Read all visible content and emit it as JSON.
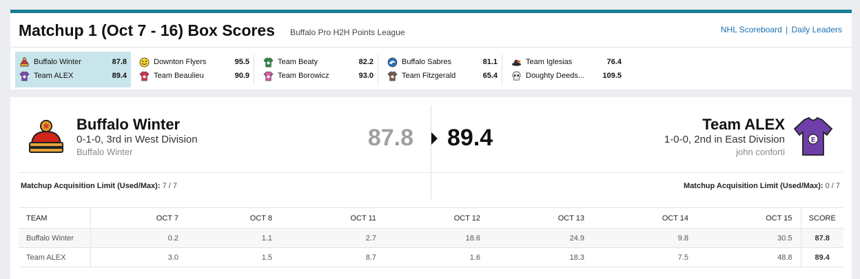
{
  "header": {
    "title": "Matchup 1 (Oct 7 - 16) Box Scores",
    "league": "Buffalo Pro H2H Points League",
    "links": [
      "NHL Scoreboard",
      "Daily Leaders"
    ],
    "separator": "|"
  },
  "matchups": [
    {
      "active": true,
      "teams": [
        {
          "name": "Buffalo Winter",
          "score": "87.8",
          "icon": "winter-hat-icon"
        },
        {
          "name": "Team ALEX",
          "score": "89.4",
          "icon": "purple-jersey-icon"
        }
      ]
    },
    {
      "active": false,
      "teams": [
        {
          "name": "Downton Flyers",
          "score": "95.5",
          "icon": "smiley-face-icon"
        },
        {
          "name": "Team Beaulieu",
          "score": "90.9",
          "icon": "red-jersey-icon"
        }
      ]
    },
    {
      "active": false,
      "teams": [
        {
          "name": "Team Beaty",
          "score": "82.2",
          "icon": "green-jersey-icon"
        },
        {
          "name": "Team Borowicz",
          "score": "93.0",
          "icon": "pink-jersey-icon"
        }
      ]
    },
    {
      "active": false,
      "teams": [
        {
          "name": "Buffalo Sabres",
          "score": "81.1",
          "icon": "sabres-logo-icon"
        },
        {
          "name": "Team Fitzgerald",
          "score": "65.4",
          "icon": "brown-jersey-icon"
        }
      ]
    },
    {
      "active": false,
      "teams": [
        {
          "name": "Team Iglesias",
          "score": "76.4",
          "icon": "hat-icon"
        },
        {
          "name": "Doughty Deeds...",
          "score": "109.5",
          "icon": "skull-icon"
        }
      ]
    }
  ],
  "left_team": {
    "name": "Buffalo Winter",
    "record": "0-1-0, 3rd in West Division",
    "owner": "Buffalo Winter",
    "score": "87.8",
    "acq_label": "Matchup Acquisition Limit (Used/Max):",
    "acq_value": "7 / 7"
  },
  "right_team": {
    "name": "Team ALEX",
    "record": "1-0-0, 2nd in East Division",
    "owner": "john conforti",
    "score": "89.4",
    "acq_label": "Matchup Acquisition Limit (Used/Max):",
    "acq_value": "0 / 7"
  },
  "table": {
    "team_header": "TEAM",
    "days": [
      "OCT 7",
      "OCT 8",
      "OCT 11",
      "OCT 12",
      "OCT 13",
      "OCT 14",
      "OCT 15"
    ],
    "score_header": "SCORE",
    "rows": [
      {
        "team": "Buffalo Winter",
        "values": [
          "0.2",
          "1.1",
          "2.7",
          "18.6",
          "24.9",
          "9.8",
          "30.5"
        ],
        "score": "87.8"
      },
      {
        "team": "Team ALEX",
        "values": [
          "3.0",
          "1.5",
          "8.7",
          "1.6",
          "18.3",
          "7.5",
          "48.8"
        ],
        "score": "89.4"
      }
    ]
  },
  "colors": {
    "accent": "#1a7e96",
    "link": "#1a6fb0",
    "active_bg": "#c9e5ec"
  }
}
